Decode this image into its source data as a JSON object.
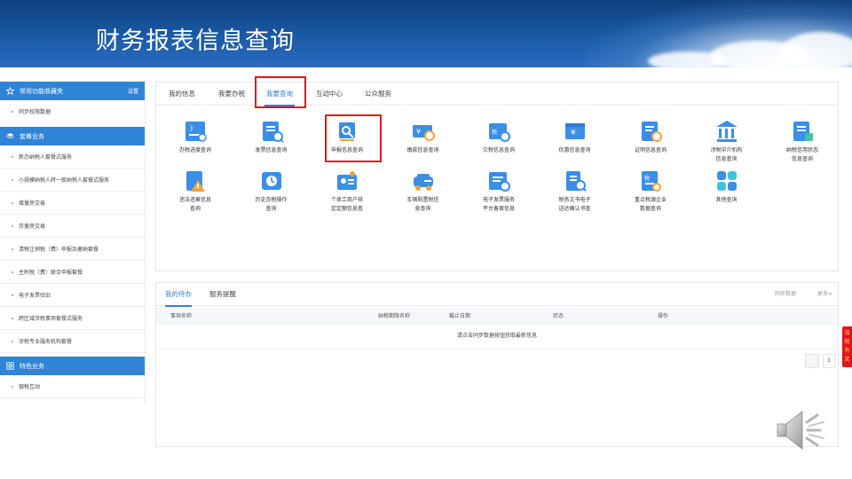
{
  "banner": {
    "title": "财务报表信息查询"
  },
  "sidebar": {
    "favorites": {
      "label": "常用功能收藏夹",
      "action": "设置",
      "items": [
        "同步权限数据"
      ]
    },
    "packages": {
      "label": "套餐业务",
      "items": [
        "新办纳税人套餐式服务",
        "小规模纳税人转一般纳税人套餐式服务",
        "增量房交易",
        "存量房交易",
        "清税注销税（费）申报及缴纳套餐",
        "主附税（费）联合申报套餐",
        "电子发票验旧",
        "跨区域涉税事项套餐式服务",
        "涉税专业服务机构套餐"
      ]
    },
    "special": {
      "label": "特色业务",
      "items": [
        "银税互动"
      ]
    }
  },
  "tabs": [
    "我的信息",
    "我要办税",
    "我要查询",
    "互动中心",
    "公众服务"
  ],
  "active_tab": "我要查询",
  "services_row1": [
    {
      "label": "办税进度查询",
      "icon": "progress-query-icon"
    },
    {
      "label": "发票信息查询",
      "icon": "invoice-query-icon"
    },
    {
      "label": "申报信息查询",
      "icon": "declaration-query-icon"
    },
    {
      "label": "缴款信息查询",
      "icon": "payment-query-icon"
    },
    {
      "label": "欠税信息查询",
      "icon": "arrears-query-icon"
    },
    {
      "label": "优惠信息查询",
      "icon": "preferential-query-icon"
    },
    {
      "label": "证明信息查询",
      "icon": "certificate-query-icon"
    },
    {
      "label": "涉税中介机构\n信息查询",
      "icon": "agency-building-icon"
    },
    {
      "label": "纳税信用状态\n信息查询",
      "icon": "credit-status-icon"
    }
  ],
  "services_row2": [
    {
      "label": "违法违章信息\n查询",
      "icon": "violation-warning-icon"
    },
    {
      "label": "历史办税操作\n查询",
      "icon": "history-operation-icon"
    },
    {
      "label": "个体工商户核\n定定额信息查",
      "icon": "individual-business-icon"
    },
    {
      "label": "车辆购置税信\n息查询",
      "icon": "vehicle-tax-icon"
    },
    {
      "label": "电子发票服务\n平台备案信息",
      "icon": "e-invoice-platform-icon"
    },
    {
      "label": "税务文书电子\n送达确认书查",
      "icon": "tax-document-icon"
    },
    {
      "label": "重点税源企业\n数据查询",
      "icon": "key-tax-source-icon"
    },
    {
      "label": "其他查询",
      "icon": "other-query-grid-icon"
    }
  ],
  "todo": {
    "tabs": [
      "我的待办",
      "服务提醒"
    ],
    "sync": "同步数据",
    "more": "更多>",
    "columns": [
      "事项名称",
      "纳税期限名称",
      "截止日期",
      "状态",
      "操作"
    ],
    "empty_text": "请点击同步数据按钮获取最新信息",
    "page": "1"
  },
  "float_tab": "加税有奖",
  "colors": {
    "banner": "#1b5aa6",
    "accent": "#2f84d8",
    "highlight": "#e0161b"
  }
}
